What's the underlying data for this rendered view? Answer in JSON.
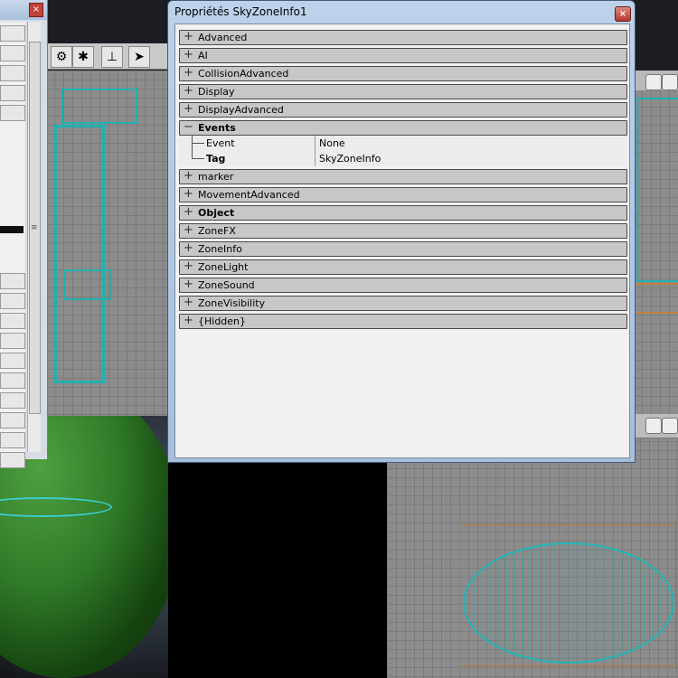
{
  "window": {
    "title": "Propriétés SkyZoneInfo1",
    "close_glyph": "×"
  },
  "left_panel": {
    "close_glyph": "×",
    "grip_glyph": "≡"
  },
  "properties": [
    {
      "label": "Advanced",
      "expanded": false,
      "bold": false
    },
    {
      "label": "AI",
      "expanded": false,
      "bold": false
    },
    {
      "label": "CollisionAdvanced",
      "expanded": false,
      "bold": false
    },
    {
      "label": "Display",
      "expanded": false,
      "bold": false
    },
    {
      "label": "DisplayAdvanced",
      "expanded": false,
      "bold": false
    },
    {
      "label": "Events",
      "expanded": true,
      "bold": true,
      "children": [
        {
          "name": "Event",
          "value": "None",
          "bold": false
        },
        {
          "name": "Tag",
          "value": "SkyZoneInfo",
          "bold": true
        }
      ]
    },
    {
      "label": "marker",
      "expanded": false,
      "bold": false
    },
    {
      "label": "MovementAdvanced",
      "expanded": false,
      "bold": false
    },
    {
      "label": "Object",
      "expanded": false,
      "bold": true
    },
    {
      "label": "ZoneFX",
      "expanded": false,
      "bold": false
    },
    {
      "label": "ZoneInfo",
      "expanded": false,
      "bold": false
    },
    {
      "label": "ZoneLight",
      "expanded": false,
      "bold": false
    },
    {
      "label": "ZoneSound",
      "expanded": false,
      "bold": false
    },
    {
      "label": "ZoneVisibility",
      "expanded": false,
      "bold": false
    },
    {
      "label": "{Hidden}",
      "expanded": false,
      "bold": false
    }
  ],
  "glyphs": {
    "collapsed": "+",
    "expanded": "−"
  },
  "icons": [
    "sliders-icon",
    "lightbulb-icon",
    "joystick-icon",
    "select-arrow-icon",
    "view-cube-icon"
  ],
  "colors": {
    "wireframe": "#20b0b0",
    "title_bar": "#bcd2ea",
    "category_row": "#c7c7c7"
  }
}
